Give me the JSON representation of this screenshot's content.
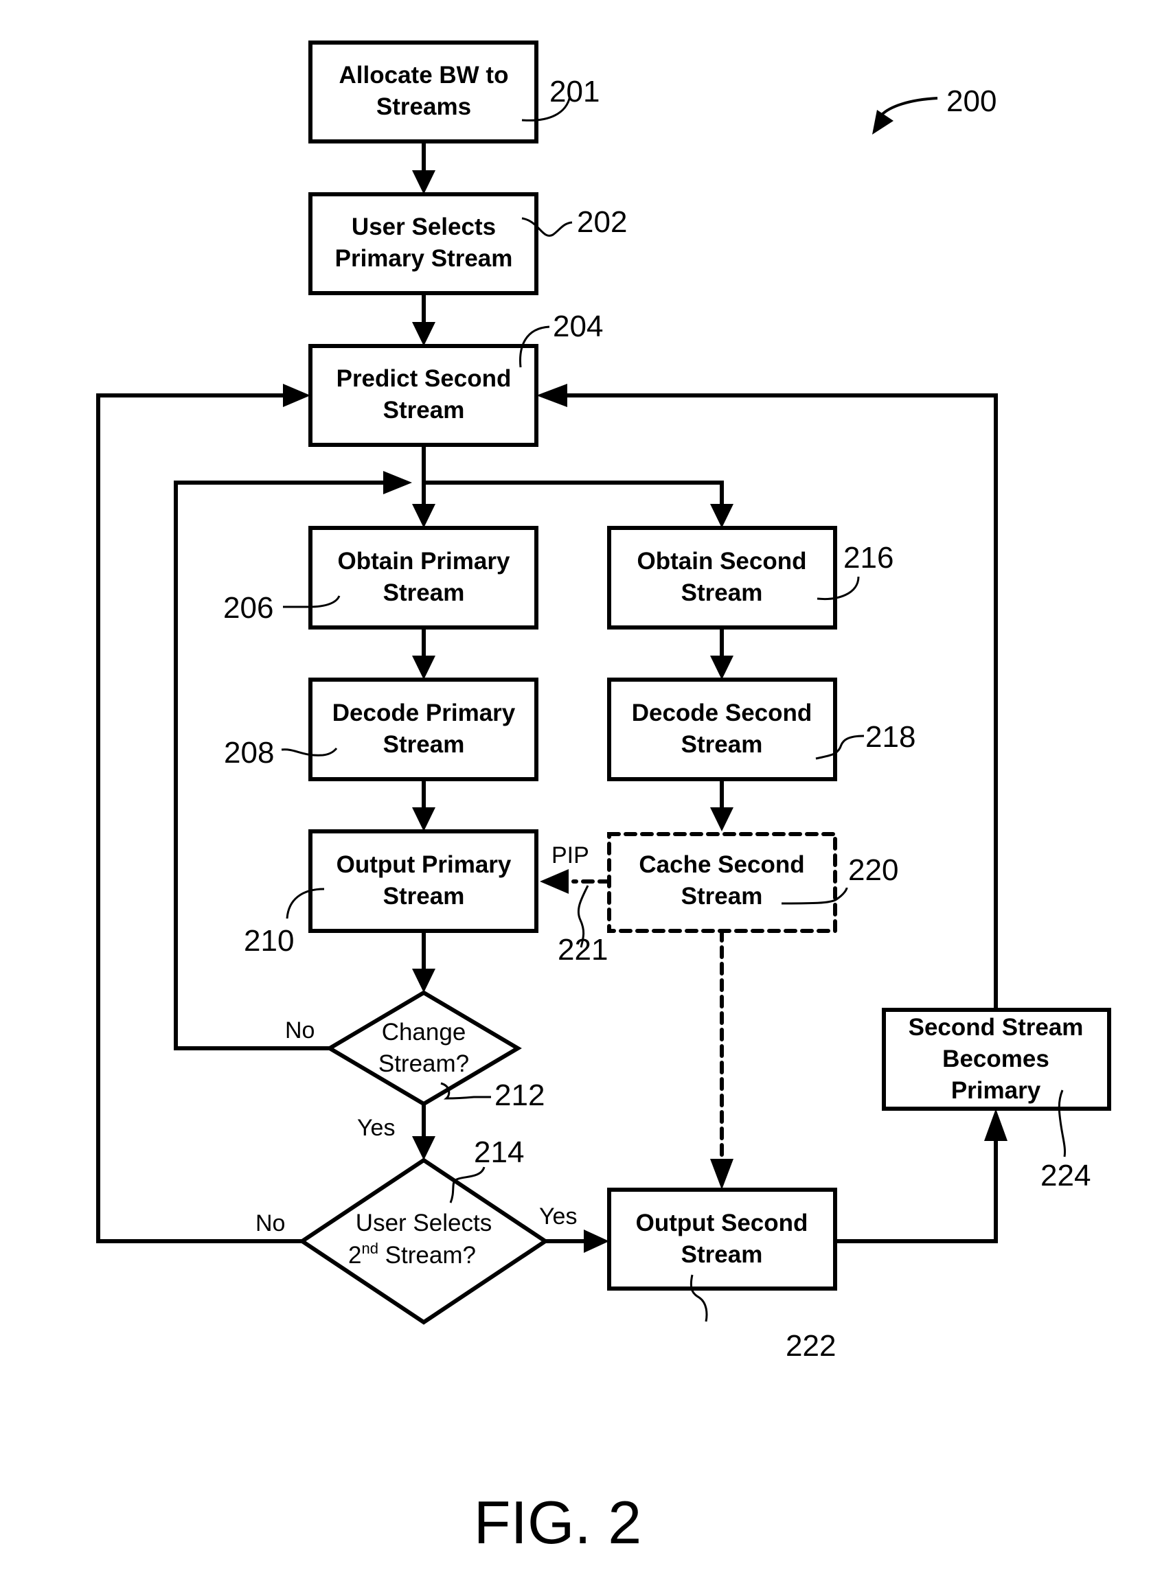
{
  "figure": {
    "label": "FIG. 2",
    "ref": "200"
  },
  "nodes": {
    "n201": {
      "ref": "201",
      "lines": [
        "Allocate BW to",
        "Streams"
      ],
      "shape": "process"
    },
    "n202": {
      "ref": "202",
      "lines": [
        "User Selects",
        "Primary Stream"
      ],
      "shape": "process"
    },
    "n204": {
      "ref": "204",
      "lines": [
        "Predict Second",
        "Stream"
      ],
      "shape": "process"
    },
    "n206": {
      "ref": "206",
      "lines": [
        "Obtain Primary",
        "Stream"
      ],
      "shape": "process"
    },
    "n208": {
      "ref": "208",
      "lines": [
        "Decode Primary",
        "Stream"
      ],
      "shape": "process"
    },
    "n210": {
      "ref": "210",
      "lines": [
        "Output Primary",
        "Stream"
      ],
      "shape": "process"
    },
    "n212": {
      "ref": "212",
      "lines": [
        "Change",
        "Stream?"
      ],
      "shape": "decision"
    },
    "n214": {
      "ref": "214",
      "lines": [
        "User Selects",
        "2",
        "nd",
        " Stream?"
      ],
      "shape": "decision"
    },
    "n216": {
      "ref": "216",
      "lines": [
        "Obtain Second",
        "Stream"
      ],
      "shape": "process"
    },
    "n218": {
      "ref": "218",
      "lines": [
        "Decode Second",
        "Stream"
      ],
      "shape": "process"
    },
    "n220": {
      "ref": "220",
      "lines": [
        "Cache Second",
        "Stream"
      ],
      "shape": "optional-process"
    },
    "n222": {
      "ref": "222",
      "lines": [
        "Output Second",
        "Stream"
      ],
      "shape": "process"
    },
    "n224": {
      "ref": "224",
      "lines": [
        "Second Stream",
        "Becomes",
        "Primary"
      ],
      "shape": "process"
    }
  },
  "edges": {
    "pip": {
      "ref": "221",
      "label": "PIP",
      "from": "n220",
      "to": "n210",
      "style": "dashed"
    },
    "change_no": {
      "label": "No",
      "from": "n212",
      "to": "n206"
    },
    "change_yes": {
      "label": "Yes",
      "from": "n212",
      "to": "n214"
    },
    "select_no": {
      "label": "No",
      "from": "n214",
      "to": "n204"
    },
    "select_yes": {
      "label": "Yes",
      "from": "n214",
      "to": "n222"
    }
  }
}
